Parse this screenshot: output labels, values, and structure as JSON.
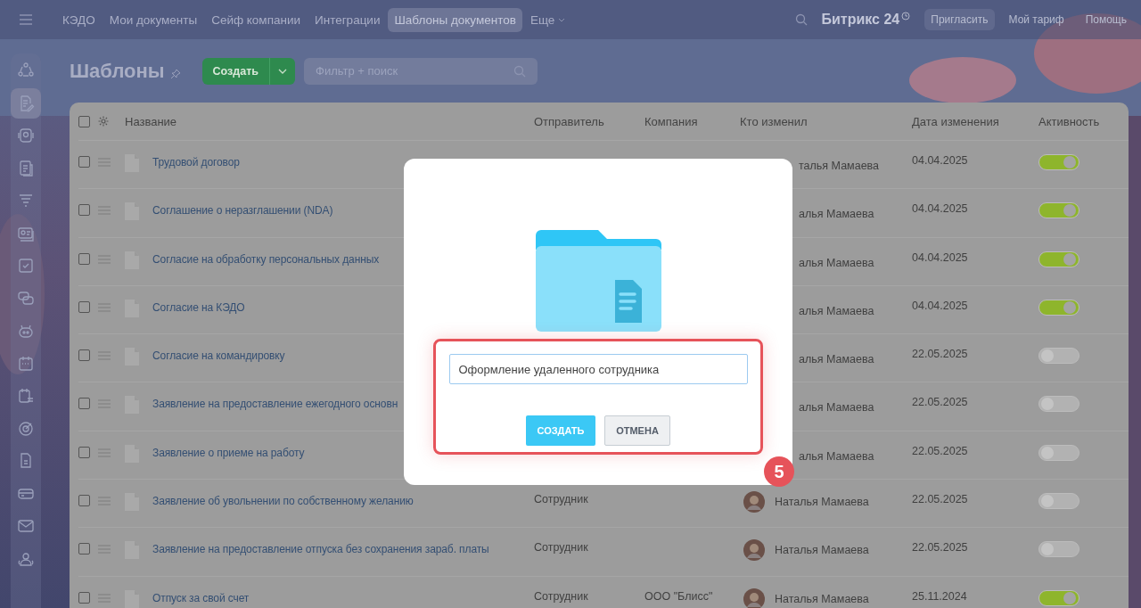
{
  "topbar": {
    "tabs": [
      {
        "label": "КЭДО",
        "selected": false
      },
      {
        "label": "Мои документы",
        "selected": false
      },
      {
        "label": "Сейф компании",
        "selected": false
      },
      {
        "label": "Интеграции",
        "selected": false
      },
      {
        "label": "Шаблоны документов",
        "selected": true
      },
      {
        "label": "Еще",
        "selected": false
      }
    ],
    "logo": "Битрикс 24",
    "invite": "Пригласить",
    "tariff": "Мой тариф",
    "help": "Помощь"
  },
  "sidebar": {
    "items": [
      {
        "selected": false
      },
      {
        "selected": true
      },
      {
        "selected": false
      },
      {
        "selected": false
      },
      {
        "selected": false
      },
      {
        "selected": false
      },
      {
        "selected": false
      },
      {
        "selected": false
      },
      {
        "selected": false
      },
      {
        "selected": false
      },
      {
        "selected": false
      },
      {
        "selected": false
      },
      {
        "selected": false
      },
      {
        "selected": false
      },
      {
        "selected": false
      },
      {
        "selected": false
      }
    ]
  },
  "header": {
    "title": "Шаблоны",
    "create": "Создать",
    "filter": {
      "placeholder": "Фильтр + поиск"
    }
  },
  "table": {
    "all_checked": false,
    "columns": [
      "Название",
      "Отправитель",
      "Компания",
      "Кто изменил",
      "Дата изменения",
      "Активность"
    ],
    "rows": [
      {
        "checked": false,
        "title": "Трудовой договор",
        "person": "талья Мамаева",
        "avatar": false,
        "date": "04.04.2025",
        "on": true
      },
      {
        "checked": false,
        "title": "Соглашение о неразглашении (NDA)",
        "person": "алья Мамаева",
        "avatar": false,
        "date": "04.04.2025",
        "on": true
      },
      {
        "checked": false,
        "title": "Согласие на обработку персональных данных",
        "person": "алья Мамаева",
        "avatar": false,
        "date": "04.04.2025",
        "on": true
      },
      {
        "checked": false,
        "title": "Согласие на КЭДО",
        "person": "алья Мамаева",
        "avatar": false,
        "date": "04.04.2025",
        "on": true
      },
      {
        "checked": false,
        "title": "Согласие на командировку",
        "person": "алья Мамаева",
        "avatar": false,
        "date": "22.05.2025",
        "on": false
      },
      {
        "checked": false,
        "title": "Заявление на предоставление ежегодного основн",
        "person": "алья Мамаева",
        "avatar": false,
        "date": "22.05.2025",
        "on": false
      },
      {
        "checked": false,
        "title": "Заявление о приеме на работу",
        "person": "алья Мамаева",
        "avatar": false,
        "date": "22.05.2025",
        "on": false
      },
      {
        "checked": false,
        "title": "Заявление об увольнении по собственному желанию",
        "sender": "Сотрудник",
        "person": "Наталья Мамаева",
        "avatar": true,
        "date": "22.05.2025",
        "on": false
      },
      {
        "checked": false,
        "title": "Заявление на предоставление отпуска без сохранения зараб. платы",
        "sender": "Сотрудник",
        "person": "Наталья Мамаева",
        "avatar": true,
        "date": "22.05.2025",
        "on": false
      },
      {
        "checked": false,
        "title": "Отпуск за свой счет",
        "sender": "Сотрудник",
        "company": "ООО \"Блисс\"",
        "person": "Наталья Мамаева",
        "avatar": true,
        "date": "25.11.2024",
        "on": true
      }
    ]
  },
  "dialog": {
    "input": "Оформление удаленного сотрудника",
    "create": "СОЗДАТЬ",
    "cancel": "ОТМЕНА",
    "step": "5"
  }
}
